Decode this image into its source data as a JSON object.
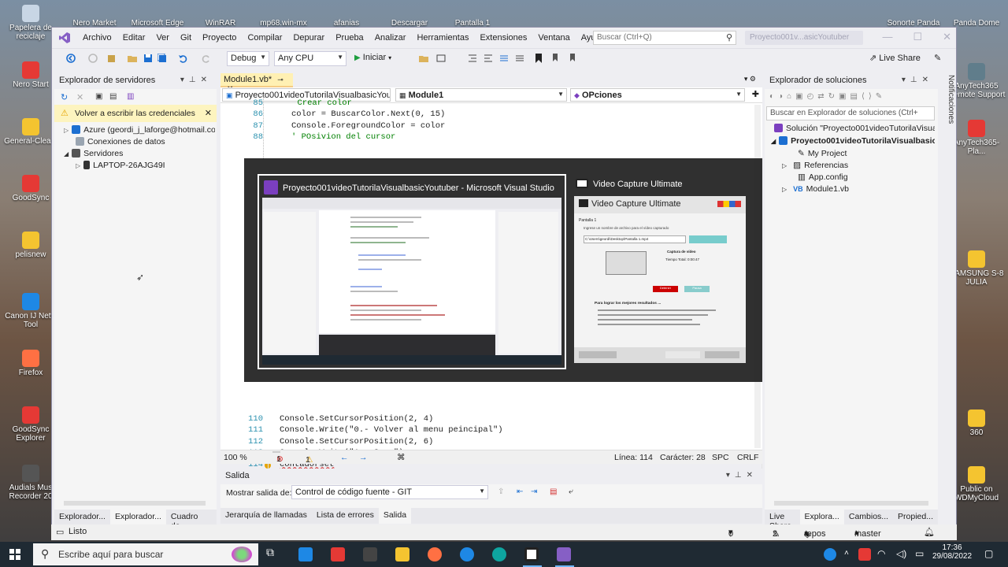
{
  "desktop": {
    "icons_left": [
      {
        "label": "Papelera de reciclaje",
        "color": "#c8d6e5"
      },
      {
        "label": "Nero Start",
        "color": "#e53935"
      },
      {
        "label": "General-Clea...",
        "color": "#f4c430"
      },
      {
        "label": "GoodSync",
        "color": "#e53935"
      },
      {
        "label": "pelisnew",
        "color": "#f4c430"
      },
      {
        "label": "Canon IJ Netw Tool",
        "color": "#1e88e5"
      },
      {
        "label": "Firefox",
        "color": "#ff7043"
      },
      {
        "label": "GoodSync Explorer",
        "color": "#e53935"
      },
      {
        "label": "Audials Mus Recorder 20",
        "color": "#555555"
      }
    ],
    "icons_top": [
      {
        "label": "Nero Market"
      },
      {
        "label": "Microsoft Edge"
      },
      {
        "label": "WinRAR"
      },
      {
        "label": "mp68.win-mx"
      },
      {
        "label": "afanias"
      },
      {
        "label": "Descargar"
      },
      {
        "label": "Pantalla 1"
      },
      {
        "label": "Sonorte Panda"
      },
      {
        "label": "Panda Dome"
      }
    ],
    "icons_right": [
      {
        "label": "AnyTech365 Remote Support",
        "color": "#607d8b"
      },
      {
        "label": "AnyTech365-Pla...",
        "color": "#e53935"
      },
      {
        "label": "SAMSUNG S-8 JULIA",
        "color": "#f4c430"
      },
      {
        "label": "360",
        "color": "#f4c430"
      },
      {
        "label": "Public on WDMyCloud",
        "color": "#f4c430"
      }
    ]
  },
  "vs": {
    "menu": [
      "Archivo",
      "Editar",
      "Ver",
      "Git",
      "Proyecto",
      "Compilar",
      "Depurar",
      "Prueba",
      "Analizar",
      "Herramientas",
      "Extensiones",
      "Ventana",
      "Ayuda"
    ],
    "search_placeholder": "Buscar (Ctrl+Q)",
    "title_badge": "Proyecto001v...asicYoutuber",
    "toolbar": {
      "config": "Debug",
      "platform": "Any CPU",
      "start": "Iniciar",
      "live_share": "Live Share"
    },
    "server_explorer": {
      "title": "Explorador de servidores",
      "warning": "Volver a escribir las credenciales",
      "items": [
        "Azure (geordi_j_laforge@hotmail.com)",
        "Conexiones de datos",
        "Servidores",
        "LAPTOP-26AJG49I"
      ],
      "tabs": [
        "Explorador...",
        "Explorador...",
        "Cuadro de..."
      ]
    },
    "editor": {
      "tab": "Module1.vb*",
      "nav_project": "Proyecto001videoTutorilaVisualbasicYoutub",
      "nav_module": "Module1",
      "nav_member": "OPciones",
      "lines_top": [
        {
          "n": "85",
          "code": "Crear color",
          "kind": "cm",
          "indent": 13
        },
        {
          "n": "86",
          "code": "color = BuscarColor.Next(0, 15)",
          "kind": "plain",
          "indent": 12
        },
        {
          "n": "87",
          "code": "Console.ForegroundColor = color",
          "kind": "plain",
          "indent": 12
        },
        {
          "n": "88",
          "code": "' POsivion del cursor",
          "kind": "cm",
          "indent": 12
        }
      ],
      "lines_bottom": [
        {
          "n": "110",
          "code": "Console.SetCursorPosition(2, 4)",
          "kind": "plain",
          "indent": 10
        },
        {
          "n": "111",
          "code": "Console.Write(\"0.- Volver al menu peincipal\")",
          "kind": "str",
          "indent": 10
        },
        {
          "n": "112",
          "code": "Console.SetCursorPosition(2, 6)",
          "kind": "plain",
          "indent": 10
        },
        {
          "n": "113",
          "code": "Console.Write(\"1.- Suma\")",
          "kind": "str",
          "indent": 10
        },
        {
          "n": "114",
          "code": "contadorset",
          "kind": "plain",
          "indent": 10
        },
        {
          "n": "115",
          "code": "",
          "kind": "plain",
          "indent": 10
        }
      ],
      "status": {
        "zoom": "100 %",
        "errors": "1",
        "warnings": "1",
        "line": "Línea: 114",
        "char": "Carácter: 28",
        "spc": "SPC",
        "crlf": "CRLF"
      }
    },
    "output": {
      "title": "Salida",
      "show_label": "Mostrar salida de:",
      "source": "Control de código fuente - GIT",
      "tabs": [
        "Jerarquía de llamadas",
        "Lista de errores",
        "Salida"
      ]
    },
    "solution_explorer": {
      "title": "Explorador de soluciones",
      "search_placeholder": "Buscar en Explorador de soluciones (Ctrl+",
      "items": [
        "Solución \"Proyecto001videoTutorilaVisualb",
        "Proyecto001videoTutorilaVisualbasicY",
        "My Project",
        "Referencias",
        "App.config",
        "Module1.vb"
      ],
      "tabs": [
        "Live Share",
        "Explora...",
        "Cambios...",
        "Propied..."
      ],
      "side_label": "Notificaciones"
    },
    "statusbar": {
      "ready": "Listo",
      "up": "0",
      "pen": "2",
      "repo": "repos",
      "branch": "master"
    }
  },
  "alttab": {
    "windows": [
      {
        "title": "Proyecto001videoTutorilaVisualbasicYoutuber - Microsoft Visual Studio",
        "accent": "#7b3fbf"
      },
      {
        "title": "Video Capture Ultimate",
        "accent": "#ffffff"
      }
    ],
    "vcu": {
      "header": "Video Capture Ultimate",
      "screen_label": "Pantalla 1",
      "prompt": "Ingrese un nombre de archivo para el vídeo capturado",
      "path": "C:\\Users\\geordi\\Desktop\\Pantalla 1.mp4",
      "section": "Captura de vídeo",
      "total_time": "Tiempo Total: 0:00:47",
      "tips_title": "Para lograr los mejores resultados ...",
      "stop": "Detener",
      "pause": "Pausa"
    }
  },
  "taskbar": {
    "search_placeholder": "Escribe aquí para buscar",
    "time": "17:36",
    "date": "29/08/2022"
  }
}
